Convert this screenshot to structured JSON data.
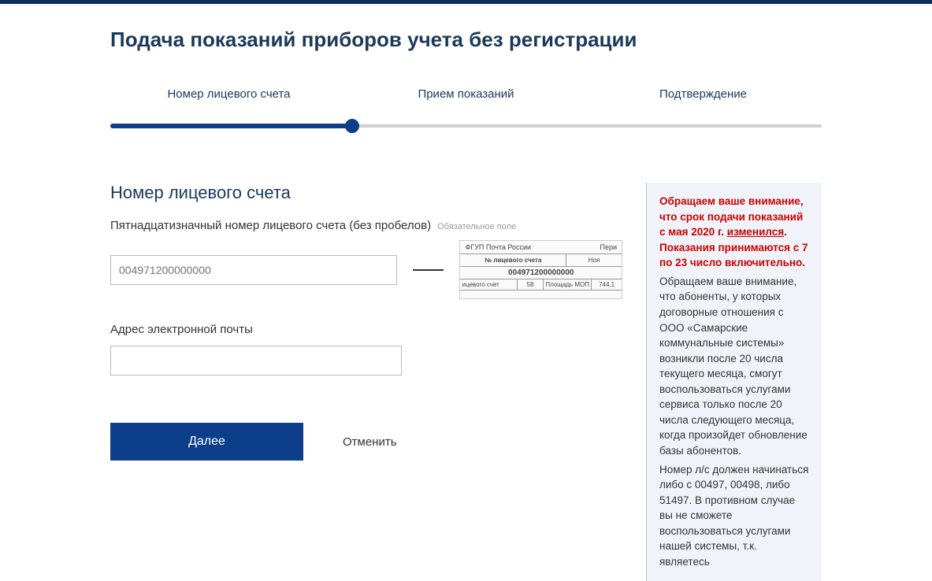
{
  "page": {
    "title": "Подача показаний приборов учета без регистрации"
  },
  "stepper": {
    "steps": [
      {
        "label": "Номер лицевого счета"
      },
      {
        "label": "Прием показаний"
      },
      {
        "label": "Подтверждение"
      }
    ]
  },
  "section": {
    "title": "Номер лицевого счета"
  },
  "account_field": {
    "label": "Пятнадцатизначный номер лицевого счета (без пробелов)",
    "required_hint": "Обязательное поле",
    "placeholder": "004971200000000"
  },
  "receipt": {
    "org": "ФГУП Почта России",
    "col_period": "Пери",
    "num_label": "№ лицевого счета",
    "number": "004971200000000",
    "month": "Ноя",
    "row2_left": "ицевого счет",
    "row2_c1": "58",
    "row2_c2_lbl": "Площадь МОП",
    "row2_c2": "744,1"
  },
  "email_field": {
    "label": "Адрес электронной почты"
  },
  "buttons": {
    "next": "Далее",
    "cancel": "Отменить"
  },
  "notice": {
    "red1": "Обращаем ваше внимание, что срок подачи показаний с мая 2020 г. ",
    "link": "изменился",
    "red1_after": ".",
    "red2": "Показания принимаются с 7 по 23 число включительно.",
    "body1": "Обращаем ваше внимание, что абоненты, у которых договорные отношения с ООО «Самарские коммунальные системы» возникли после 20 числа текущего месяца, смогут воспользоваться услугами сервиса только после 20 числа следующего месяца, когда произойдет обновление базы абонентов.",
    "body2": "Номер л/с должен начинаться либо с 00497, 00498, либо 51497. В противном случае вы не сможете воспользоваться услугами нашей системы, т.к. являетесь"
  }
}
